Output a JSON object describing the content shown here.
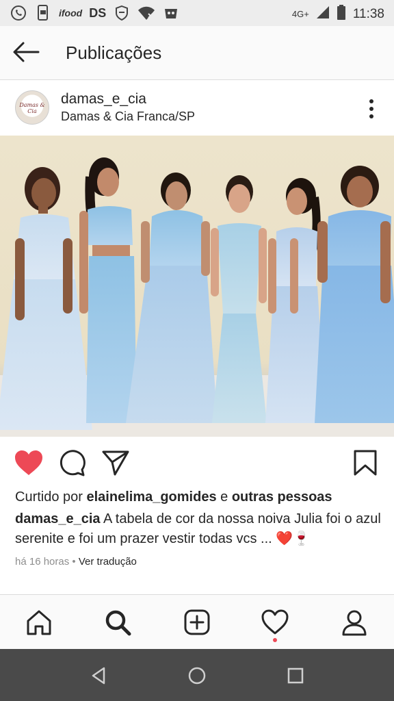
{
  "status_bar": {
    "app_icons": [
      "whatsapp-icon",
      "phone-message-icon",
      "ifood-icon",
      "ds-icon",
      "shield-icon",
      "wifi-off-icon",
      "gamepad-icon"
    ],
    "ifood_text": "ifood",
    "ds_text": "DS",
    "network": "4G+",
    "time": "11:38"
  },
  "header": {
    "title": "Publicações"
  },
  "post": {
    "username": "damas_e_cia",
    "location": "Damas & Cia Franca/SP",
    "avatar_text": "Damas & Cia",
    "liked": true,
    "likes_prefix": "Curtido por",
    "liked_by": "elainelima_gomides",
    "likes_and": "e",
    "likes_others": "outras pessoas",
    "caption_user": "damas_e_cia",
    "caption_text": "A tabela de cor da nossa noiva Julia foi o azul serenite e foi um prazer vestir todas vcs ... ❤️🍷",
    "time_ago": "há 16 horas",
    "separator": "•",
    "translate": "Ver tradução"
  },
  "colors": {
    "like_red": "#ed4956",
    "dress_blue": "#9cc6ea",
    "wall": "#ece3c9"
  },
  "tabs": [
    "home-icon",
    "search-icon",
    "new-post-icon",
    "activity-icon",
    "profile-icon"
  ],
  "nav": [
    "back-triangle-icon",
    "home-circle-icon",
    "recents-square-icon"
  ]
}
